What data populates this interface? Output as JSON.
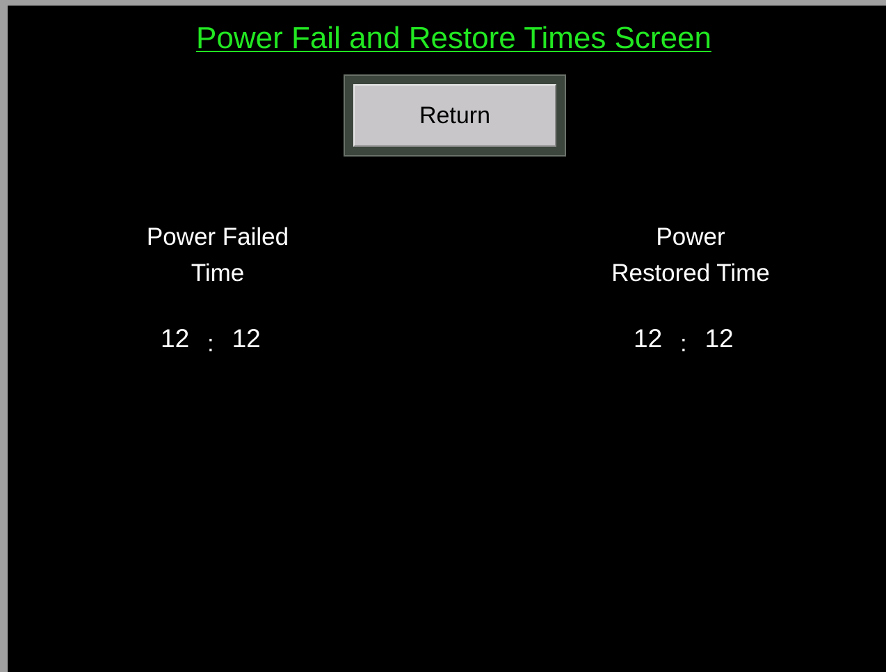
{
  "screen": {
    "title": "Power Fail and Restore Times Screen",
    "return_label": "Return"
  },
  "power_failed": {
    "label_line1": "Power Failed",
    "label_line2": "Time",
    "hours": "12",
    "separator": ":",
    "minutes": "12"
  },
  "power_restored": {
    "label_line1": "Power",
    "label_line2": "Restored Time",
    "hours": "12",
    "separator": ":",
    "minutes": "12"
  },
  "colors": {
    "background": "#000000",
    "title": "#22e822",
    "text": "#ffffff",
    "button_face": "#c8c6c8",
    "button_border": "#3c463c"
  }
}
